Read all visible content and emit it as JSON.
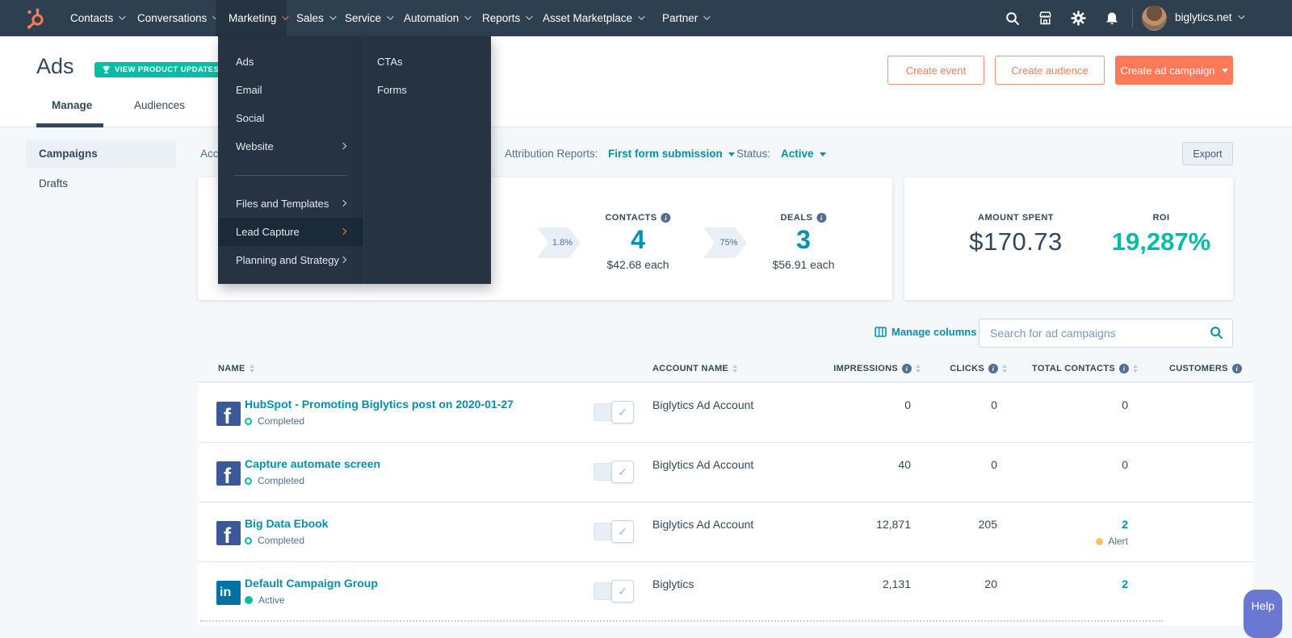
{
  "colors": {
    "accent_orange": "#ff7a59",
    "link_teal": "#0091ae",
    "success_green": "#00bda5",
    "navy": "#33475b",
    "navbar_bg": "#2e3f50",
    "help_purple": "#6b78d2",
    "alert_yellow": "#f5c26b"
  },
  "icons": {
    "logo": "hubspot-sprocket",
    "search": "magnifier",
    "marketplace": "storefront",
    "settings": "gear",
    "notifications": "bell",
    "badge": "trophy",
    "manage_columns": "columns-grid",
    "facebook_glyph": "f",
    "linkedin_glyph": "in",
    "toggle_check": "checkmark"
  },
  "navbar": {
    "items": [
      {
        "label": "Contacts"
      },
      {
        "label": "Conversations"
      },
      {
        "label": "Marketing"
      },
      {
        "label": "Sales"
      },
      {
        "label": "Service"
      },
      {
        "label": "Automation"
      },
      {
        "label": "Reports"
      },
      {
        "label": "Asset Marketplace"
      },
      {
        "label": "Partner"
      }
    ],
    "account": "biglytics.net"
  },
  "menu": {
    "items": [
      {
        "label": "Ads"
      },
      {
        "label": "Email"
      },
      {
        "label": "Social"
      },
      {
        "label": "Website"
      },
      {
        "label": "Files and Templates"
      },
      {
        "label": "Lead Capture"
      },
      {
        "label": "Planning and Strategy"
      }
    ],
    "submenu": [
      {
        "label": "CTAs"
      },
      {
        "label": "Forms"
      }
    ]
  },
  "header": {
    "title": "Ads",
    "badge": "VIEW PRODUCT UPDATES",
    "create_event": "Create event",
    "create_audience": "Create audience",
    "create_campaign": "Create ad campaign"
  },
  "tabs": [
    {
      "label": "Manage"
    },
    {
      "label": "Audiences"
    }
  ],
  "sidebar": {
    "items": [
      {
        "label": "Campaigns"
      },
      {
        "label": "Drafts"
      }
    ]
  },
  "filters": {
    "account_partial": "Acc",
    "attribution_label": "Attribution Reports:",
    "attribution_value": "First form submission",
    "status_label": "Status:",
    "status_value": "Active",
    "export_label": "Export"
  },
  "stats": {
    "funnel": {
      "step1_rate": "1.8%",
      "contacts_label": "CONTACTS",
      "contacts_value": "4",
      "contacts_each": "$42.68 each",
      "step2_rate": "75%",
      "deals_label": "DEALS",
      "deals_value": "3",
      "deals_each": "$56.91 each"
    },
    "summary": {
      "spent_label": "AMOUNT SPENT",
      "spent_value": "$170.73",
      "roi_label": "ROI",
      "roi_value": "19,287%"
    }
  },
  "table": {
    "manage_columns": "Manage columns",
    "search_placeholder": "Search for ad campaigns",
    "columns": [
      "NAME",
      "ACCOUNT NAME",
      "IMPRESSIONS",
      "CLICKS",
      "TOTAL CONTACTS",
      "CUSTOMERS"
    ],
    "rows": [
      {
        "network": "facebook",
        "name": "HubSpot - Promoting Biglytics post on 2020-01-27",
        "status": "Completed",
        "account": "Biglytics Ad Account",
        "impressions": "0",
        "clicks": "0",
        "total_contacts": "0"
      },
      {
        "network": "facebook",
        "name": "Capture automate screen",
        "status": "Completed",
        "account": "Biglytics Ad Account",
        "impressions": "40",
        "clicks": "0",
        "total_contacts": "0"
      },
      {
        "network": "facebook",
        "name": "Big Data Ebook",
        "status": "Completed",
        "account": "Biglytics Ad Account",
        "impressions": "12,871",
        "clicks": "205",
        "total_contacts": "2",
        "alert": "Alert"
      },
      {
        "network": "linkedin",
        "name": "Default Campaign Group",
        "status": "Active",
        "account": "Biglytics",
        "impressions": "2,131",
        "clicks": "20",
        "total_contacts": "2"
      }
    ]
  },
  "help_label": "Help"
}
